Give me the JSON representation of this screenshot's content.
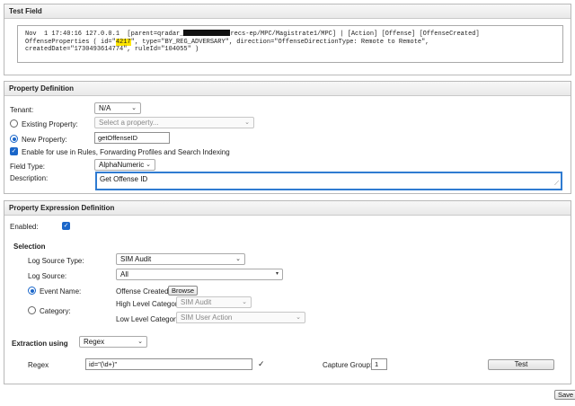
{
  "test_field": {
    "title": "Test Field",
    "line1_pre": "Nov  1 17:40:16 127.0.0.1  [parent=qradar_",
    "line1_post": "recs-ep/MPC/Magistrate1/MPC] | [Action] [Offense] [OffenseCreated]",
    "line2_pre": "OffenseProperties ( id=\"",
    "line2_hl": "4217",
    "line2_post": "\", type=\"BY_REG_ADVERSARY\", direction=\"OffenseDirectionType: Remote to Remote\",",
    "line3": "createdDate=\"1730493614774\", ruleId=\"104055\" )"
  },
  "property_definition": {
    "title": "Property Definition",
    "tenant_label": "Tenant:",
    "tenant_value": "N/A",
    "existing_label": "Existing Property:",
    "existing_placeholder": "Select a property...",
    "new_label": "New Property:",
    "new_value": "getOffenseID",
    "enable_label": "Enable for use in Rules, Forwarding Profiles and Search Indexing",
    "field_type_label": "Field Type:",
    "field_type_value": "AlphaNumeric",
    "description_label": "Description:",
    "description_value": "Get Offense ID"
  },
  "expression": {
    "title": "Property Expression Definition",
    "enabled_label": "Enabled:",
    "selection_label": "Selection",
    "log_source_type_label": "Log Source Type:",
    "log_source_type_value": "SIM Audit",
    "log_source_label": "Log Source:",
    "log_source_value": "All",
    "event_name_label": "Event Name:",
    "event_name_value": "Offense Created",
    "browse_label": "Browse",
    "category_label": "Category:",
    "high_cat_label": "High Level Category",
    "high_cat_value": "SIM Audit",
    "low_cat_label": "Low Level Category",
    "low_cat_value": "SIM User Action",
    "extraction_label": "Extraction using",
    "extraction_value": "Regex",
    "regex_label": "Regex",
    "regex_value": "id=\"(\\d+)\"",
    "capture_group_label": "Capture Group:",
    "capture_group_value": "1",
    "test_label": "Test"
  },
  "footer": {
    "save_label": "Save"
  },
  "icons": {
    "caret": "chevron-down-icon",
    "valid": "checkmark-icon",
    "resize": "resize-grip-icon"
  },
  "colors": {
    "accent": "#1a66c9",
    "highlight": "#ffe600"
  }
}
